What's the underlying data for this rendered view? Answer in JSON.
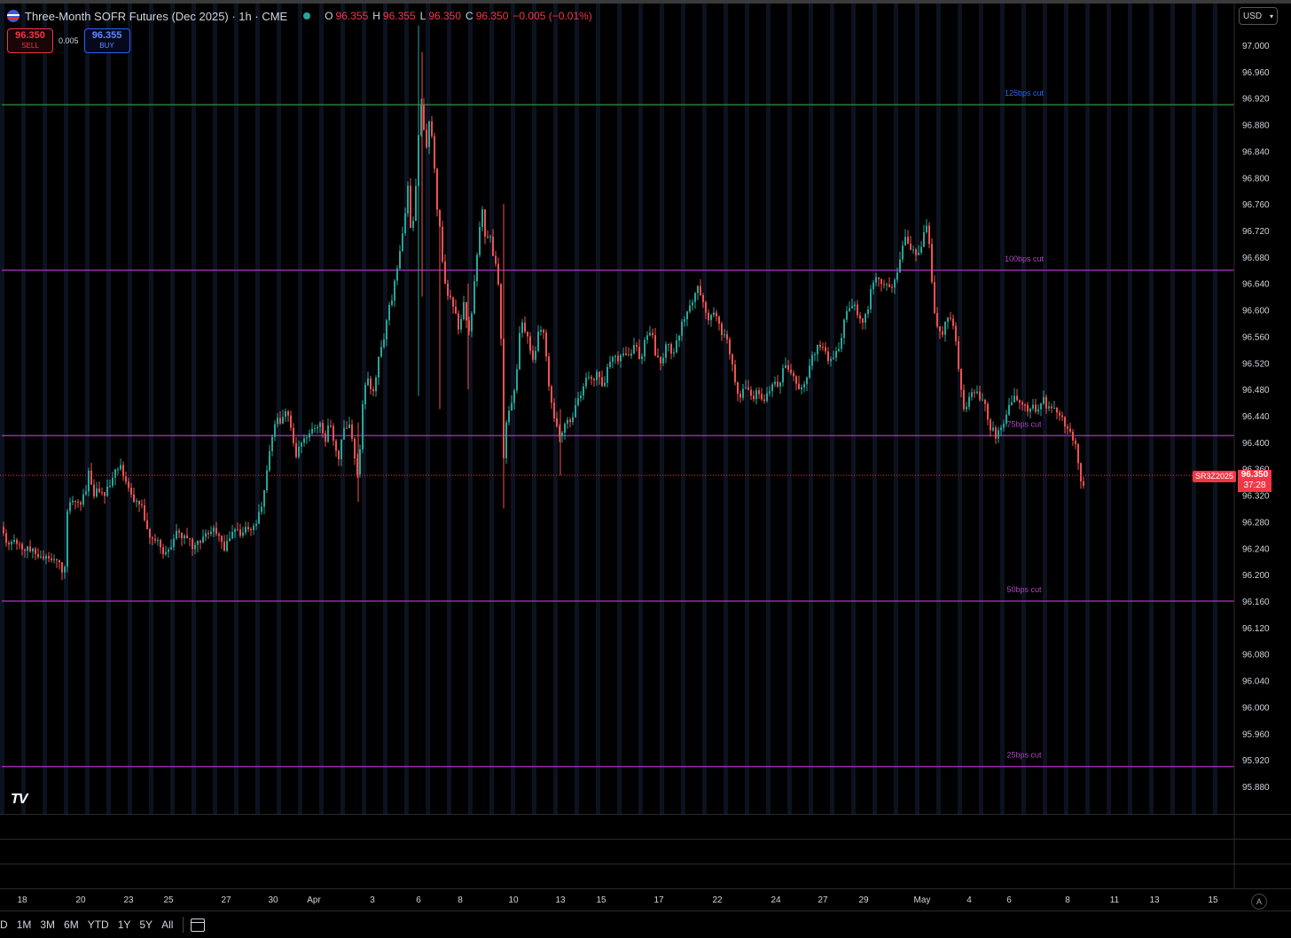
{
  "header": {
    "symbol_title": "Three-Month SOFR Futures (Dec 2025) · 1h · CME",
    "ohlc": [
      {
        "k": "O",
        "v": "96.355"
      },
      {
        "k": "H",
        "v": "96.355"
      },
      {
        "k": "L",
        "v": "96.350"
      },
      {
        "k": "C",
        "v": "96.350"
      }
    ],
    "change": "−0.005 (−0.01%)"
  },
  "trade": {
    "sell_price": "96.350",
    "sell_label": "SELL",
    "spread": "0.005",
    "buy_price": "96.355",
    "buy_label": "BUY"
  },
  "currency": "USD",
  "last_price_badge": {
    "ticker": "SR3Z2025",
    "price": "96.350",
    "countdown": "37:28"
  },
  "logo_text": "TV",
  "ranges": [
    "D",
    "1M",
    "3M",
    "6M",
    "YTD",
    "1Y",
    "5Y",
    "All"
  ],
  "auto_scale_label": "A",
  "colors": {
    "up": "#26a69a",
    "down": "#ef5350",
    "bg": "#000000",
    "last_price": "#f23645",
    "green_line": "#2e7d32",
    "purple_line": "#9c27b0"
  },
  "chart_data": {
    "type": "candlestick",
    "title": "Three-Month SOFR Futures (Dec 2025)",
    "interval": "1h",
    "exchange": "CME",
    "yaxis_ticks": [
      "97.000",
      "96.960",
      "96.920",
      "96.880",
      "96.840",
      "96.800",
      "96.760",
      "96.720",
      "96.680",
      "96.640",
      "96.600",
      "96.560",
      "96.520",
      "96.480",
      "96.440",
      "96.400",
      "96.360",
      "96.320",
      "96.280",
      "96.240",
      "96.200",
      "96.160",
      "96.120",
      "96.080",
      "96.040",
      "96.000",
      "95.960",
      "95.920",
      "95.880"
    ],
    "ylim": [
      95.86,
      97.03
    ],
    "x_ticks": [
      "18",
      "20",
      "23",
      "25",
      "27",
      "30",
      "Apr",
      "3",
      "6",
      "8",
      "10",
      "13",
      "15",
      "17",
      "22",
      "24",
      "27",
      "29",
      "May",
      "4",
      "6",
      "8",
      "11",
      "13",
      "15"
    ],
    "horizontal_levels": [
      {
        "label": "125bps cut",
        "value": 96.91,
        "color": "#2e7d32",
        "label_color": "#2962ff"
      },
      {
        "label": "100bps cut",
        "value": 96.66,
        "color": "#9c27b0",
        "label_color": "#ab47bc"
      },
      {
        "label": "75bps cut",
        "value": 96.41,
        "color": "#9c27b0",
        "label_color": "#ab47bc"
      },
      {
        "label": "50bps cut",
        "value": 96.16,
        "color": "#9c27b0",
        "label_color": "#ab47bc"
      },
      {
        "label": "25bps cut",
        "value": 95.91,
        "color": "#9c27b0",
        "label_color": "#ab47bc"
      }
    ],
    "last_price": 96.35,
    "price_path": [
      [
        0,
        96.28
      ],
      [
        5,
        96.26
      ],
      [
        10,
        96.24
      ],
      [
        18,
        96.25
      ],
      [
        25,
        96.24
      ],
      [
        33,
        96.24
      ],
      [
        40,
        96.23
      ],
      [
        48,
        96.23
      ],
      [
        55,
        96.22
      ],
      [
        62,
        96.23
      ],
      [
        68,
        96.22
      ],
      [
        72,
        96.19
      ],
      [
        76,
        96.3
      ],
      [
        80,
        96.32
      ],
      [
        86,
        96.31
      ],
      [
        92,
        96.31
      ],
      [
        97,
        96.33
      ],
      [
        100,
        96.36
      ],
      [
        106,
        96.32
      ],
      [
        112,
        96.33
      ],
      [
        118,
        96.32
      ],
      [
        124,
        96.34
      ],
      [
        130,
        96.36
      ],
      [
        136,
        96.37
      ],
      [
        141,
        96.34
      ],
      [
        148,
        96.32
      ],
      [
        155,
        96.31
      ],
      [
        160,
        96.3
      ],
      [
        165,
        96.27
      ],
      [
        170,
        96.25
      ],
      [
        176,
        96.25
      ],
      [
        182,
        96.24
      ],
      [
        188,
        96.23
      ],
      [
        194,
        96.25
      ],
      [
        200,
        96.27
      ],
      [
        206,
        96.25
      ],
      [
        212,
        96.26
      ],
      [
        218,
        96.24
      ],
      [
        224,
        96.25
      ],
      [
        230,
        96.26
      ],
      [
        236,
        96.26
      ],
      [
        242,
        96.27
      ],
      [
        248,
        96.25
      ],
      [
        254,
        96.24
      ],
      [
        260,
        96.26
      ],
      [
        266,
        96.27
      ],
      [
        272,
        96.26
      ],
      [
        278,
        96.27
      ],
      [
        284,
        96.27
      ],
      [
        290,
        96.28
      ],
      [
        296,
        96.31
      ],
      [
        302,
        96.37
      ],
      [
        307,
        96.41
      ],
      [
        312,
        96.44
      ],
      [
        318,
        96.43
      ],
      [
        324,
        96.45
      ],
      [
        328,
        96.42
      ],
      [
        334,
        96.38
      ],
      [
        338,
        96.39
      ],
      [
        342,
        96.4
      ],
      [
        348,
        96.41
      ],
      [
        354,
        96.42
      ],
      [
        360,
        96.43
      ],
      [
        366,
        96.4
      ],
      [
        372,
        96.43
      ],
      [
        378,
        96.39
      ],
      [
        382,
        96.38
      ],
      [
        388,
        96.42
      ],
      [
        394,
        96.43
      ],
      [
        400,
        96.38
      ],
      [
        404,
        96.34
      ],
      [
        408,
        96.45
      ],
      [
        414,
        96.5
      ],
      [
        420,
        96.47
      ],
      [
        426,
        96.52
      ],
      [
        432,
        96.55
      ],
      [
        438,
        96.6
      ],
      [
        444,
        96.63
      ],
      [
        450,
        96.68
      ],
      [
        456,
        96.73
      ],
      [
        460,
        96.79
      ],
      [
        464,
        96.7
      ],
      [
        468,
        96.76
      ],
      [
        472,
        96.86
      ],
      [
        476,
        96.92
      ],
      [
        480,
        96.83
      ],
      [
        484,
        96.88
      ],
      [
        488,
        96.86
      ],
      [
        492,
        96.76
      ],
      [
        496,
        96.72
      ],
      [
        500,
        96.65
      ],
      [
        506,
        96.62
      ],
      [
        512,
        96.6
      ],
      [
        518,
        96.57
      ],
      [
        524,
        96.62
      ],
      [
        528,
        96.55
      ],
      [
        532,
        96.6
      ],
      [
        536,
        96.65
      ],
      [
        540,
        96.72
      ],
      [
        544,
        96.75
      ],
      [
        548,
        96.7
      ],
      [
        552,
        96.72
      ],
      [
        556,
        96.68
      ],
      [
        560,
        96.66
      ],
      [
        564,
        96.62
      ],
      [
        568,
        96.38
      ],
      [
        572,
        96.44
      ],
      [
        578,
        96.46
      ],
      [
        582,
        96.5
      ],
      [
        586,
        96.56
      ],
      [
        590,
        96.58
      ],
      [
        596,
        96.55
      ],
      [
        602,
        96.52
      ],
      [
        608,
        96.58
      ],
      [
        614,
        96.56
      ],
      [
        618,
        96.5
      ],
      [
        622,
        96.46
      ],
      [
        628,
        96.42
      ],
      [
        632,
        96.4
      ],
      [
        638,
        96.44
      ],
      [
        644,
        96.43
      ],
      [
        650,
        96.46
      ],
      [
        656,
        96.47
      ],
      [
        662,
        96.5
      ],
      [
        668,
        96.49
      ],
      [
        674,
        96.51
      ],
      [
        680,
        96.48
      ],
      [
        686,
        96.52
      ],
      [
        692,
        96.53
      ],
      [
        698,
        96.52
      ],
      [
        704,
        96.54
      ],
      [
        710,
        96.53
      ],
      [
        716,
        96.55
      ],
      [
        722,
        96.52
      ],
      [
        728,
        96.56
      ],
      [
        734,
        96.57
      ],
      [
        740,
        96.53
      ],
      [
        746,
        96.52
      ],
      [
        752,
        96.55
      ],
      [
        758,
        96.53
      ],
      [
        764,
        96.56
      ],
      [
        770,
        96.58
      ],
      [
        776,
        96.6
      ],
      [
        782,
        96.62
      ],
      [
        788,
        96.64
      ],
      [
        794,
        96.6
      ],
      [
        800,
        96.58
      ],
      [
        806,
        96.6
      ],
      [
        812,
        96.57
      ],
      [
        818,
        96.56
      ],
      [
        824,
        96.53
      ],
      [
        830,
        96.48
      ],
      [
        836,
        96.47
      ],
      [
        842,
        96.49
      ],
      [
        848,
        96.46
      ],
      [
        854,
        96.48
      ],
      [
        860,
        96.46
      ],
      [
        866,
        96.47
      ],
      [
        872,
        96.49
      ],
      [
        878,
        96.48
      ],
      [
        884,
        96.52
      ],
      [
        890,
        96.51
      ],
      [
        896,
        96.5
      ],
      [
        902,
        96.48
      ],
      [
        908,
        96.49
      ],
      [
        914,
        96.52
      ],
      [
        920,
        96.54
      ],
      [
        926,
        96.55
      ],
      [
        932,
        96.53
      ],
      [
        938,
        96.52
      ],
      [
        944,
        96.54
      ],
      [
        948,
        96.55
      ],
      [
        954,
        96.6
      ],
      [
        960,
        96.61
      ],
      [
        966,
        96.6
      ],
      [
        972,
        96.58
      ],
      [
        978,
        96.6
      ],
      [
        984,
        96.64
      ],
      [
        990,
        96.65
      ],
      [
        996,
        96.64
      ],
      [
        1002,
        96.63
      ],
      [
        1008,
        96.64
      ],
      [
        1014,
        96.67
      ],
      [
        1018,
        96.7
      ],
      [
        1022,
        96.71
      ],
      [
        1028,
        96.69
      ],
      [
        1034,
        96.68
      ],
      [
        1040,
        96.7
      ],
      [
        1046,
        96.74
      ],
      [
        1050,
        96.66
      ],
      [
        1054,
        96.6
      ],
      [
        1058,
        96.56
      ],
      [
        1064,
        96.57
      ],
      [
        1070,
        96.59
      ],
      [
        1076,
        96.58
      ],
      [
        1080,
        96.52
      ],
      [
        1084,
        96.48
      ],
      [
        1088,
        96.44
      ],
      [
        1092,
        96.47
      ],
      [
        1098,
        96.48
      ],
      [
        1104,
        96.47
      ],
      [
        1110,
        96.46
      ],
      [
        1114,
        96.43
      ],
      [
        1118,
        96.42
      ],
      [
        1124,
        96.41
      ],
      [
        1130,
        96.42
      ],
      [
        1134,
        96.44
      ],
      [
        1140,
        96.46
      ],
      [
        1146,
        96.47
      ],
      [
        1152,
        96.46
      ],
      [
        1158,
        96.45
      ],
      [
        1164,
        96.46
      ],
      [
        1170,
        96.44
      ],
      [
        1176,
        96.47
      ],
      [
        1182,
        96.45
      ],
      [
        1188,
        96.46
      ],
      [
        1194,
        96.44
      ],
      [
        1200,
        96.43
      ],
      [
        1206,
        96.42
      ],
      [
        1212,
        96.4
      ],
      [
        1216,
        96.37
      ],
      [
        1220,
        96.33
      ],
      [
        1224,
        96.35
      ]
    ],
    "grid": false,
    "legend": "none"
  }
}
